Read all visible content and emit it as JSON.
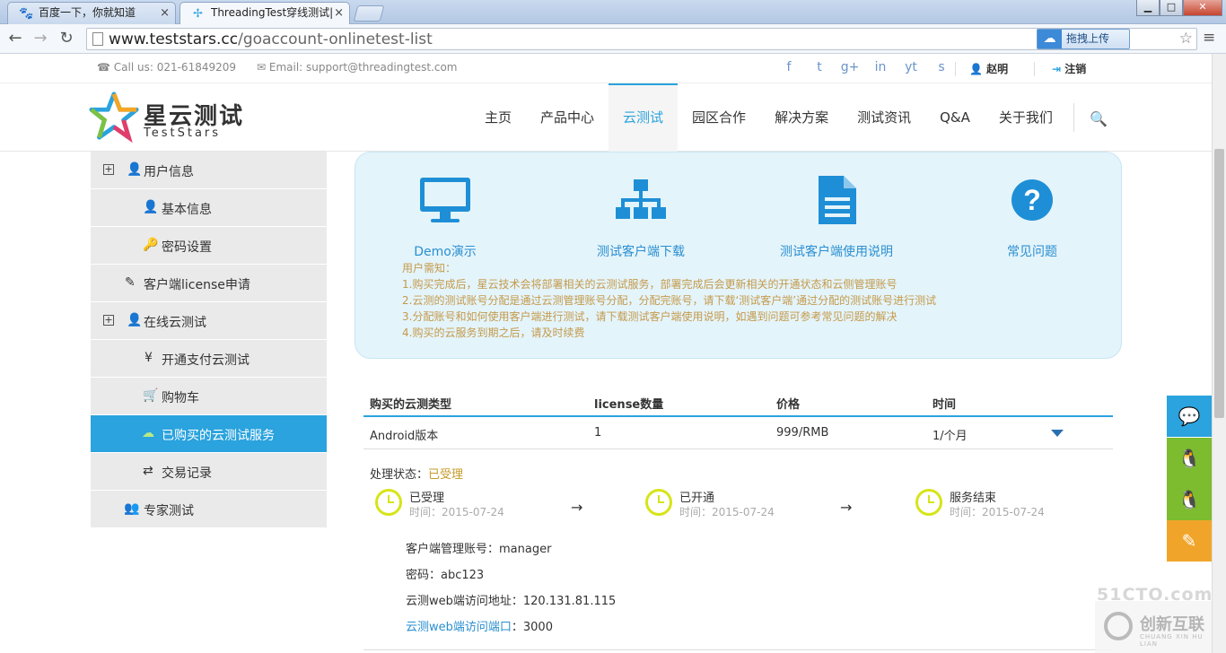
{
  "browser": {
    "tabs": [
      {
        "title": "百度一下，你就知道",
        "close": "×"
      },
      {
        "title": "ThreadingTest穿线测试|",
        "close": "×"
      }
    ],
    "window_buttons": {
      "minimize": "▁",
      "maximize": "□",
      "close": "✕"
    },
    "url_host": "www.teststars.cc",
    "url_path": "/goaccount-onlinetest-list",
    "extension_label": "拖拽上传",
    "icons": {
      "back": "arrow-left-icon",
      "forward": "arrow-right-icon",
      "reload": "reload-icon",
      "star": "star-icon",
      "menu": "menu-icon"
    }
  },
  "topinfo": {
    "phone": "Call us: 021-61849209",
    "email": "Email: support@threadingtest.com",
    "social_icons": [
      "f",
      "t",
      "g+",
      "in",
      "yt",
      "s"
    ],
    "username": "赵明",
    "logout": "注销"
  },
  "header": {
    "logo_cn": "星云测试",
    "logo_en": "TestStars",
    "nav": [
      "主页",
      "产品中心",
      "云测试",
      "园区合作",
      "解决方案",
      "测试资讯",
      "Q&A",
      "关于我们"
    ],
    "active_nav": "云测试"
  },
  "sidebar": [
    {
      "label": "用户信息",
      "icon": "user-icon",
      "group": true
    },
    {
      "label": "基本信息",
      "icon": "user-icon"
    },
    {
      "label": "密码设置",
      "icon": "key-icon"
    },
    {
      "label": "客户端license申请",
      "icon": "edit-icon"
    },
    {
      "label": "在线云测试",
      "icon": "user-icon",
      "group": true
    },
    {
      "label": "开通支付云测试",
      "icon": "yen-icon"
    },
    {
      "label": "购物车",
      "icon": "cart-icon"
    },
    {
      "label": "已购买的云测试服务",
      "icon": "cloud-icon",
      "active": true
    },
    {
      "label": "交易记录",
      "icon": "exchange-icon"
    },
    {
      "label": "专家测试",
      "icon": "users-icon"
    }
  ],
  "features": [
    {
      "label": "Demo演示",
      "icon": "monitor-icon"
    },
    {
      "label": "测试客户端下载",
      "icon": "sitemap-icon"
    },
    {
      "label": "测试客户端使用说明",
      "icon": "document-icon"
    },
    {
      "label": "常见问题",
      "icon": "question-icon"
    }
  ],
  "notice": {
    "title": "用户需知：",
    "lines": [
      "1.购买完成后，星云技术会将部署相关的云测试服务，部署完成后会更新相关的开通状态和云侧管理账号",
      "2.云测的测试账号分配是通过云测管理账号分配，分配完账号，请下载‘测试客户端’通过分配的测试账号进行测试",
      "3.分配账号和如何使用客户端进行测试，请下载测试客户端使用说明，如遇到问题可参考常见问题的解决",
      "4.购买的云服务到期之后，请及时续费"
    ]
  },
  "table": {
    "headers": [
      "购买的云测类型",
      "license数量",
      "价格",
      "时间"
    ],
    "row": [
      "Android版本",
      "1",
      "999/RMB",
      "1/个月"
    ]
  },
  "status": {
    "label": "处理状态：",
    "value": "已受理",
    "steps": [
      {
        "title": "已受理",
        "time": "时间：2015-07-24"
      },
      {
        "title": "已开通",
        "time": "时间：2015-07-24"
      },
      {
        "title": "服务结束",
        "time": "时间：2015-07-24"
      }
    ],
    "arrow": "→"
  },
  "account": {
    "manager": "客户端管理账号：manager",
    "password": "密码：abc123",
    "web_address": "云测web端访问地址：120.131.81.115",
    "port_label": "云测web端访问端口",
    "port_value": "：3000"
  },
  "float_buttons": [
    {
      "icon": "chat-bubble-icon",
      "color": "#2aa3de"
    },
    {
      "icon": "qq-icon",
      "color": "#7dbb2f"
    },
    {
      "icon": "qq-icon",
      "color": "#7dbb2f"
    },
    {
      "icon": "edit-icon",
      "color": "#f0a52a"
    }
  ],
  "watermarks": {
    "site1": "51CTO.com",
    "site2_cn": "创新互联",
    "site2_en": "CHUANG XIN HU LIAN"
  },
  "colors": {
    "accent": "#2aa3de",
    "notice_text": "#c49a4a",
    "clock": "#d7e418"
  }
}
